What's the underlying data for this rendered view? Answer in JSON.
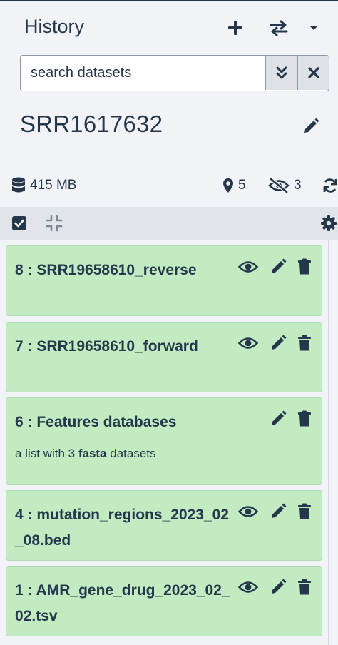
{
  "panel": {
    "title": "History",
    "new_history_icon": "plus-icon",
    "switch_history_icon": "exchange-icon",
    "options_icon": "caret-down-icon"
  },
  "search": {
    "placeholder": "search datasets",
    "advanced_icon": "double-chevron-down-icon",
    "clear_icon": "close-icon"
  },
  "history": {
    "name": "SRR1617632",
    "edit_icon": "pencil-icon"
  },
  "stats": {
    "size": "415 MB",
    "size_icon": "database-icon",
    "deleted_count": "5",
    "deleted_icon": "map-marker-icon",
    "hidden_count": "3",
    "hidden_icon": "eye-slash-icon",
    "refresh_icon": "refresh-icon"
  },
  "toolbar": {
    "select_all_icon": "checkbox-checked-icon",
    "collapse_icon": "compress-icon",
    "settings_icon": "gear-icon"
  },
  "datasets": [
    {
      "title": "8 : SRR19658610_reverse",
      "actions": [
        "eye-icon",
        "pencil-icon",
        "trash-icon"
      ]
    },
    {
      "title": "7 : SRR19658610_forward",
      "actions": [
        "eye-icon",
        "pencil-icon",
        "trash-icon"
      ]
    },
    {
      "title": "6 : Features databases",
      "subtitle_prefix": "a list with 3",
      "subtitle_bold": "fasta",
      "subtitle_suffix": "datasets",
      "actions": [
        "pencil-icon",
        "trash-icon"
      ]
    },
    {
      "title": "4 : mutation_regions_2023_02_08.bed",
      "actions": [
        "eye-icon",
        "pencil-icon",
        "trash-icon"
      ]
    },
    {
      "title": "1 : AMR_gene_drug_2023_02_02.tsv",
      "actions": [
        "eye-icon",
        "pencil-icon",
        "trash-icon"
      ]
    }
  ],
  "colors": {
    "text": "#25374a",
    "dataset_ok_bg": "#c2ebc2",
    "toolbar_bg": "#e1e4e8",
    "panel_bg": "#f2f3f6"
  }
}
